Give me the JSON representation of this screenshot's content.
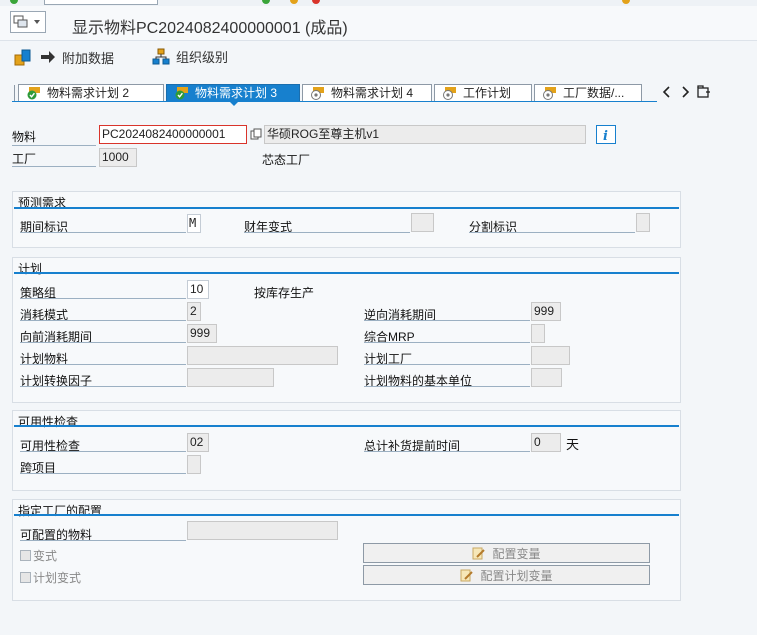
{
  "window": {
    "title": "显示物料PC2024082400000001 (成品)"
  },
  "toolbar": {
    "additional_data": "附加数据",
    "org_levels": "组织级别"
  },
  "tabs": [
    {
      "label": "物料需求计划 2",
      "active": false
    },
    {
      "label": "物料需求计划 3",
      "active": true
    },
    {
      "label": "物料需求计划 4",
      "active": false
    },
    {
      "label": "工作计划",
      "active": false
    },
    {
      "label": "工厂数据/...",
      "active": false
    }
  ],
  "header": {
    "material_label": "物料",
    "material_value": "PC2024082400000001",
    "material_desc": "华硕ROG至尊主机v1",
    "plant_label": "工厂",
    "plant_value": "1000",
    "plant_desc": "芯态工厂"
  },
  "forecast": {
    "title": "预测需求",
    "period_ind_label": "期间标识",
    "period_ind_value": "M",
    "fiscal_variant_label": "财年变式",
    "fiscal_variant_value": "",
    "split_ind_label": "分割标识",
    "split_ind_value": ""
  },
  "planning": {
    "title": "计划",
    "strategy_group_label": "策略组",
    "strategy_group_value": "10",
    "strategy_group_desc": "按库存生产",
    "consumption_mode_label": "消耗模式",
    "consumption_mode_value": "2",
    "bwd_period_label": "逆向消耗期间",
    "bwd_period_value": "999",
    "fwd_period_label": "向前消耗期间",
    "fwd_period_value": "999",
    "mixed_mrp_label": "综合MRP",
    "mixed_mrp_value": "",
    "planning_material_label": "计划物料",
    "planning_material_value": "",
    "planning_plant_label": "计划工厂",
    "planning_plant_value": "",
    "conv_factor_label": "计划转换因子",
    "conv_factor_value": "",
    "base_unit_label": "计划物料的基本单位",
    "base_unit_value": ""
  },
  "availability": {
    "title": "可用性检查",
    "check_label": "可用性检查",
    "check_value": "02",
    "total_repl_label": "总计补货提前时间",
    "total_repl_value": "0",
    "total_repl_unit": "天",
    "cross_project_label": "跨项目",
    "cross_project_value": ""
  },
  "config": {
    "title": "指定工厂的配置",
    "configurable_label": "可配置的物料",
    "configurable_value": "",
    "variant_label": "变式",
    "planning_variant_label": "计划变式",
    "config_variant_btn": "配置变量",
    "config_planning_variant_btn": "配置计划变量"
  },
  "colors": {
    "accent": "#1780ce",
    "required": "#d9342b"
  }
}
